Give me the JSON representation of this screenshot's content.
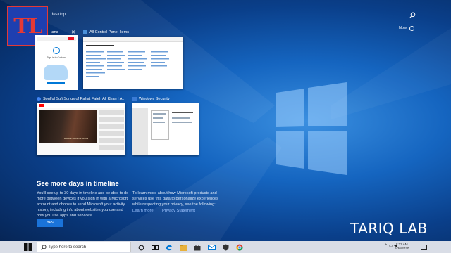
{
  "desktop": {
    "label": "desktop"
  },
  "logo": {
    "text": "TL"
  },
  "windows": [
    {
      "title": "tana"
    },
    {
      "title": "All Control Panel Items"
    },
    {
      "title": "Soulful Sufi Songs of Rahat Fateh Ali Khan | A..."
    },
    {
      "title": "Windows Security"
    }
  ],
  "cortana_thumb": {
    "line1": "Sign in to Cortana"
  },
  "youtube_thumb": {
    "video_text": "DARDE JIGAR AI KHAN"
  },
  "promo": {
    "title": "See more days in timeline",
    "left_text": "You'll see up to 30 days in timeline and be able to do more between devices if you sign in with a Microsoft account and choose to send Microsoft your activity history, including info about websites you use and how you use apps and services.",
    "right_text": "To learn more about how Microsoft products and services use this data to personalize experiences while respecting your privacy, see the following:",
    "learn_more": "Learn more",
    "privacy": "Privacy Statement",
    "yes": "Yes"
  },
  "timeline": {
    "now_label": "Now"
  },
  "watermark": {
    "text": "TARIQ LAB"
  },
  "taskbar": {
    "search_placeholder": "Type here to search",
    "time": "3:23 AM",
    "date": "5/26/2020"
  },
  "colors": {
    "accent": "#0078d7",
    "logo_red": "#e53935",
    "logo_blue": "#1e3fb0"
  }
}
